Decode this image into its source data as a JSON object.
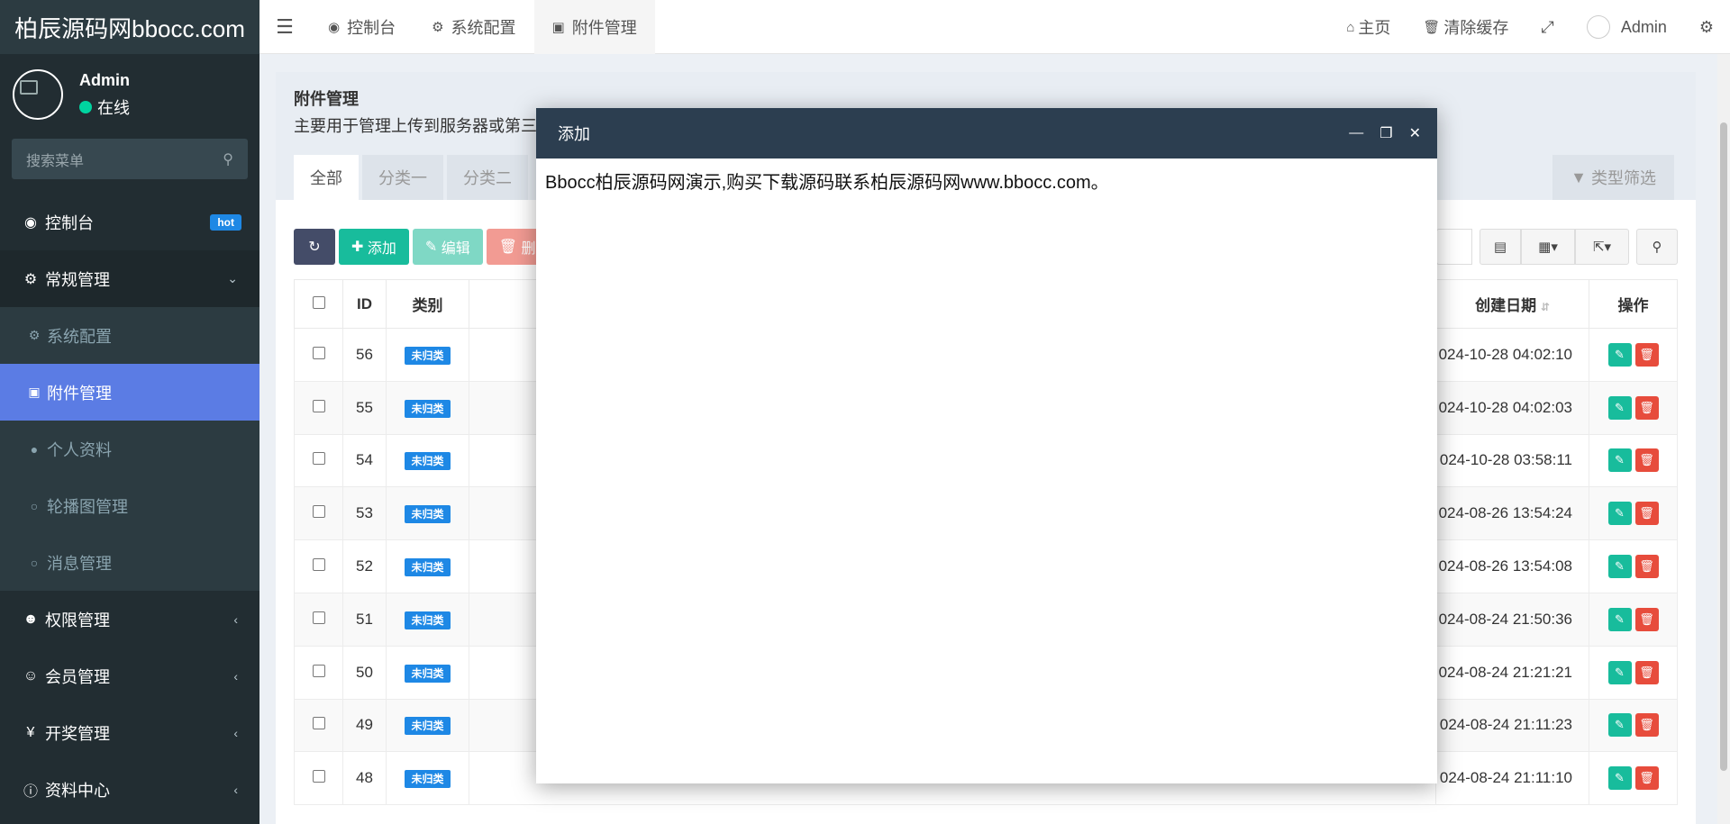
{
  "app": {
    "logo": "柏辰源码网bbocc.com"
  },
  "user": {
    "name": "Admin",
    "status": "在线"
  },
  "sidebar": {
    "search_placeholder": "搜索菜单",
    "items": [
      {
        "label": "控制台",
        "icon": "dashboard-icon",
        "badge": "hot"
      },
      {
        "label": "常规管理",
        "icon": "cogs-icon"
      },
      {
        "label": "系统配置",
        "icon": "gear-icon"
      },
      {
        "label": "附件管理",
        "icon": "image-file-icon"
      },
      {
        "label": "个人资料",
        "icon": "user-icon"
      },
      {
        "label": "轮播图管理",
        "icon": "circle-icon"
      },
      {
        "label": "消息管理",
        "icon": "circle-icon"
      },
      {
        "label": "权限管理",
        "icon": "users-icon"
      },
      {
        "label": "会员管理",
        "icon": "user-circle-icon"
      },
      {
        "label": "开奖管理",
        "icon": "yen-icon"
      },
      {
        "label": "资料中心",
        "icon": "info-icon"
      }
    ]
  },
  "header": {
    "tabs": [
      {
        "label": "控制台"
      },
      {
        "label": "系统配置"
      },
      {
        "label": "附件管理"
      }
    ],
    "home": "主页",
    "clear_cache": "清除缓存",
    "admin": "Admin"
  },
  "panel": {
    "title": "附件管理",
    "desc": "主要用于管理上传到服务器或第三",
    "tabs": [
      "全部",
      "分类一",
      "分类二"
    ],
    "type_filter": "类型筛选"
  },
  "toolbar": {
    "add": "添加",
    "edit": "编辑",
    "delete": "删"
  },
  "table": {
    "headers": {
      "id": "ID",
      "category": "类别",
      "created": "创建日期",
      "action": "操作"
    },
    "rows": [
      {
        "id": "56",
        "category": "未归类",
        "created": "024-10-28 04:02:10"
      },
      {
        "id": "55",
        "category": "未归类",
        "created": "024-10-28 04:02:03"
      },
      {
        "id": "54",
        "category": "未归类",
        "created": "024-10-28 03:58:11"
      },
      {
        "id": "53",
        "category": "未归类",
        "created": "024-08-26 13:54:24"
      },
      {
        "id": "52",
        "category": "未归类",
        "created": "024-08-26 13:54:08"
      },
      {
        "id": "51",
        "category": "未归类",
        "created": "024-08-24 21:50:36"
      },
      {
        "id": "50",
        "category": "未归类",
        "created": "024-08-24 21:21:21"
      },
      {
        "id": "49",
        "category": "未归类",
        "created": "024-08-24 21:11:23"
      },
      {
        "id": "48",
        "category": "未归类",
        "created": "024-08-24 21:11:10"
      }
    ]
  },
  "modal": {
    "title": "添加",
    "body": "Bbocc柏辰源码网演示,购买下载源码联系柏辰源码网www.bbocc.com。"
  }
}
